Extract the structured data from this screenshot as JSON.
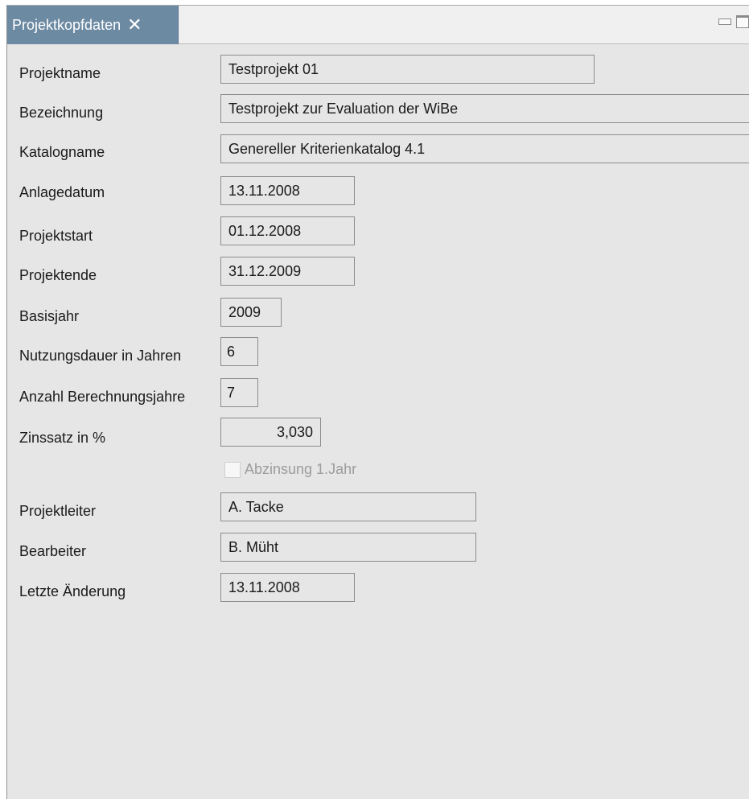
{
  "tab": {
    "title": "Projektkopfdaten",
    "close_glyph": "✕"
  },
  "form": {
    "projektname": {
      "label": "Projektname",
      "value": "Testprojekt 01"
    },
    "bezeichnung": {
      "label": "Bezeichnung",
      "value": "Testprojekt zur Evaluation der WiBe"
    },
    "katalogname": {
      "label": "Katalogname",
      "value": "Genereller Kriterienkatalog 4.1"
    },
    "anlagedatum": {
      "label": "Anlagedatum",
      "value": "13.11.2008"
    },
    "projektstart": {
      "label": "Projektstart",
      "value": "01.12.2008"
    },
    "projektende": {
      "label": "Projektende",
      "value": "31.12.2009"
    },
    "basisjahr": {
      "label": "Basisjahr",
      "value": "2009"
    },
    "nutzungsdauer": {
      "label": "Nutzungsdauer in Jahren",
      "value": "6"
    },
    "berechnungsjahre": {
      "label": "Anzahl Berechnungsjahre",
      "value": "7"
    },
    "zinssatz": {
      "label": "Zinssatz in %",
      "value": "3,030"
    },
    "abzinsung": {
      "label": "Abzinsung 1.Jahr",
      "checked": false,
      "enabled": false
    },
    "projektleiter": {
      "label": "Projektleiter",
      "value": "A. Tacke"
    },
    "bearbeiter": {
      "label": "Bearbeiter",
      "value": "B. Müht"
    },
    "letzte_aenderung": {
      "label": "Letzte Änderung",
      "value": "13.11.2008"
    }
  },
  "colors": {
    "tab_active": "#6d8aa3",
    "panel_bg": "#e6e6e6",
    "field_border": "#8c8c8c"
  }
}
